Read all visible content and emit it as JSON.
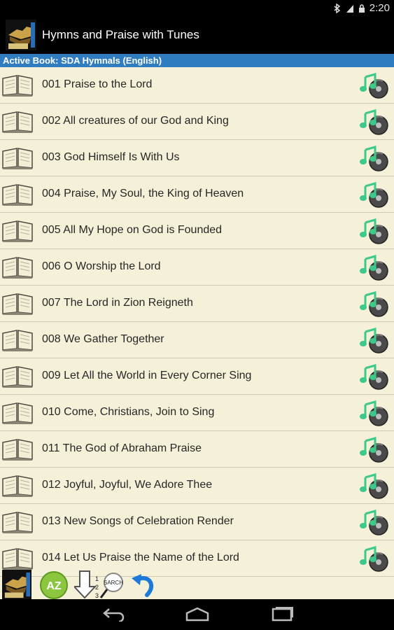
{
  "status": {
    "time": "2:20"
  },
  "app": {
    "title": "Hymns and Praise with Tunes"
  },
  "active_book": "Active Book: SDA Hymnals (English)",
  "hymns": [
    "001 Praise to the Lord",
    "002 All creatures of our God and King",
    "003 God Himself Is With Us",
    "004 Praise, My Soul, the King of Heaven",
    "005 All My Hope on God is Founded",
    "006 O Worship the Lord",
    "007 The Lord in Zion Reigneth",
    "008 We Gather Together",
    "009 Let All the World in Every Corner Sing",
    "010 Come, Christians, Join to Sing",
    "011 The God of Abraham Praise",
    "012 Joyful, Joyful, We Adore Thee",
    "013 New Songs of Celebration Render",
    "014 Let Us Praise the Name of the Lord"
  ],
  "toolbar": {
    "az_label": "AZ",
    "search_label": "SARCH"
  },
  "colors": {
    "accent": "#2f7cc0",
    "list_bg": "#f5f1d9",
    "note_green": "#3cc98a"
  }
}
